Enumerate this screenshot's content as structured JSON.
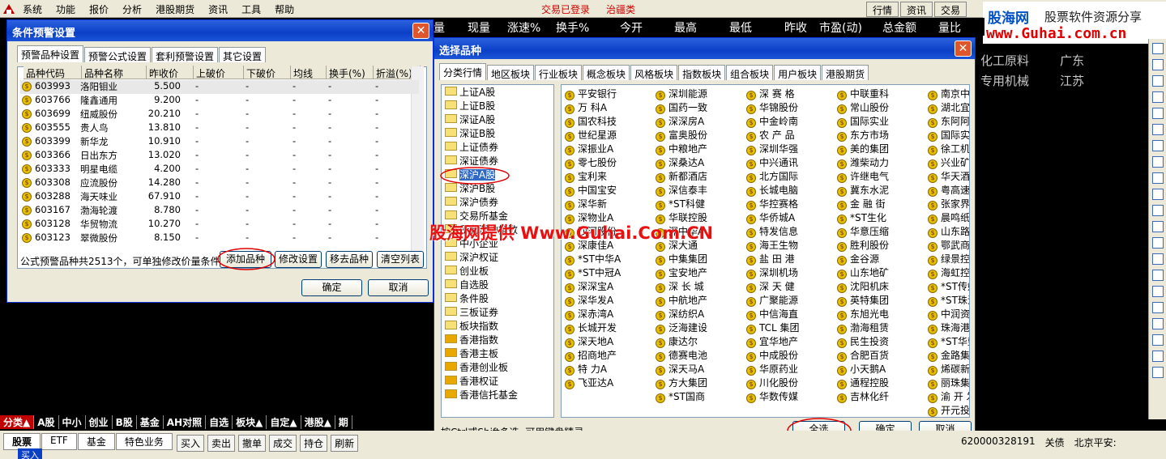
{
  "menubar": {
    "items": [
      "系统",
      "功能",
      "报价",
      "分析",
      "港股期货",
      "资讯",
      "工具",
      "帮助"
    ],
    "status_login": "交易已登录",
    "status_stock": "治疆类",
    "right_tabs": [
      "行情",
      "资讯",
      "交易"
    ]
  },
  "site": {
    "logo": "股海网",
    "slogan": "股票软件资源分享",
    "url": "www.Guhai.com.cn"
  },
  "quote_header": [
    "量",
    "现量",
    "涨速%",
    "换手%",
    "今开",
    "最高",
    "最低",
    "昨收",
    "市盈(动)",
    "总金额",
    "量比"
  ],
  "right_rows": [
    [
      "化工原料",
      "广东"
    ],
    [
      "专用机械",
      "江苏"
    ]
  ],
  "alert_dialog": {
    "title": "条件预警设置",
    "tabs": [
      "预警品种设置",
      "预警公式设置",
      "套利预警设置",
      "其它设置"
    ],
    "columns": [
      "品种代码",
      "品种名称",
      "昨收价",
      "上破价",
      "下破价",
      "均线",
      "换手(%)",
      "折溢(%)"
    ],
    "rows": [
      [
        "603993",
        "洛阳钼业",
        "5.500",
        "-",
        "-",
        "-",
        "-",
        "-"
      ],
      [
        "603766",
        "隆鑫通用",
        "9.200",
        "-",
        "-",
        "-",
        "-",
        "-"
      ],
      [
        "603699",
        "纽威股份",
        "20.210",
        "-",
        "-",
        "-",
        "-",
        "-"
      ],
      [
        "603555",
        "贵人鸟",
        "13.810",
        "-",
        "-",
        "-",
        "-",
        "-"
      ],
      [
        "603399",
        "新华龙",
        "10.910",
        "-",
        "-",
        "-",
        "-",
        "-"
      ],
      [
        "603366",
        "日出东方",
        "13.020",
        "-",
        "-",
        "-",
        "-",
        "-"
      ],
      [
        "603333",
        "明星电缆",
        "4.200",
        "-",
        "-",
        "-",
        "-",
        "-"
      ],
      [
        "603308",
        "应流股份",
        "14.280",
        "-",
        "-",
        "-",
        "-",
        "-"
      ],
      [
        "603288",
        "海天味业",
        "67.910",
        "-",
        "-",
        "-",
        "-",
        "-"
      ],
      [
        "603167",
        "渤海轮渡",
        "8.780",
        "-",
        "-",
        "-",
        "-",
        "-"
      ],
      [
        "603128",
        "华贸物流",
        "10.270",
        "-",
        "-",
        "-",
        "-",
        "-"
      ],
      [
        "603123",
        "翠微股份",
        "8.150",
        "-",
        "-",
        "-",
        "-",
        "-"
      ]
    ],
    "footer_text": "公式预警品种共2513个，可单独修改价量条件",
    "buttons": {
      "add": "添加品种",
      "modify": "修改设置",
      "remove": "移去品种",
      "clear": "清空列表",
      "ok": "确定",
      "cancel": "取消"
    }
  },
  "select_dialog": {
    "title": "选择品种",
    "tabs": [
      "分类行情",
      "地区板块",
      "行业板块",
      "概念板块",
      "风格板块",
      "指数板块",
      "组合板块",
      "用户板块",
      "港股期货"
    ],
    "folders": [
      "上证A股",
      "上证B股",
      "深证A股",
      "深证B股",
      "上证债券",
      "深证债券",
      "深沪A股",
      "深沪B股",
      "深沪债券",
      "交易所基金",
      "所有深沪指数",
      "中小企业",
      "深沪权证",
      "创业板",
      "自选股",
      "条件股",
      "三板证券",
      "板块指数",
      "香港指数",
      "香港主板",
      "香港创业板",
      "香港权证",
      "香港信托基金"
    ],
    "stocks": [
      [
        "平安银行",
        "万 科A",
        "国农科技",
        "世纪星源",
        "深振业A",
        "零七股份",
        "宝利来",
        "中国宝安",
        "深华新",
        "深物业A",
        "沙河股份",
        "深康佳A",
        "*ST中华A",
        "*ST中冠A",
        "深深宝A",
        "深华发A",
        "深赤湾A",
        "长城开发",
        "深天地A",
        "招商地产",
        "特 力A",
        "飞亚达A"
      ],
      [
        "深圳能源",
        "国药一致",
        "深深房A",
        "富奥股份",
        "中粮地产",
        "深桑达A",
        "新都酒店",
        "深信泰丰",
        "*ST科健",
        "华联控股",
        "深中华A",
        "深大通",
        "中集集团",
        "宝安地产",
        "深 长 城",
        "中航地产",
        "深纺织A",
        "泛海建设",
        "康达尔",
        "德赛电池",
        "深天马A",
        "方大集团",
        "*ST国商"
      ],
      [
        "深 赛 格",
        "华锦股份",
        "中金岭南",
        "农 产 品",
        "深圳华强",
        "中兴通讯",
        "北方国际",
        "长城电脑",
        "华控赛格",
        "华侨城A",
        "特发信息",
        "海王生物",
        "盐 田 港",
        "深圳机场",
        "深 天 健",
        "广聚能源",
        "中信海直",
        "TCL 集团",
        "宜华地产",
        "中成股份",
        "华原药业",
        "川化股份",
        "华数传媒"
      ],
      [
        "中联重科",
        "常山股份",
        "国际实业",
        "东方市场",
        "美的集团",
        "潍柴动力",
        "许继电气",
        "冀东水泥",
        "金 融 街",
        "*ST生化",
        "华意压缩",
        "胜利股份",
        "金谷源",
        "山东地矿",
        "沈阳机床",
        "英特集团",
        "东旭光电",
        "渤海租赁",
        "民生投资",
        "合肥百货",
        "小天鹅A",
        "通程控股",
        "吉林化纤"
      ],
      [
        "南京中北",
        "湖北宜化",
        "东阿阿胶",
        "国际实业",
        "徐工机械",
        "兴业矿业",
        "华天酒店",
        "粤高速A",
        "张家界",
        "晨鸣纸业",
        "山东路桥",
        "鄂武商A",
        "绿景控股",
        "海虹控股",
        "*ST传媒",
        "*ST珠江",
        "中润资源",
        "珠海港",
        "*ST华塑",
        "金路集团",
        "烯碳新材",
        "丽珠集团",
        "渝 开 发",
        "开元投资"
      ]
    ],
    "status_text": "按Ctrl或Shift多选, 可用键盘精灵",
    "buttons": {
      "select_all": "全选",
      "ok": "确定",
      "cancel": "取消"
    }
  },
  "watermark": "股海网提供 Www.Guhai.Com.CN",
  "bottom_tabs": [
    "分类▲",
    "A股",
    "中小",
    "创业",
    "B股",
    "基金",
    "AH对照",
    "自选",
    "板块▲",
    "自定▲",
    "港股▲",
    "期"
  ],
  "trade": {
    "tabs": [
      "股票",
      "ETF",
      "基金",
      "特色业务"
    ],
    "buttons": [
      "买入",
      "卖出",
      "撤单",
      "成交",
      "持仓",
      "刷新"
    ],
    "buy_label": "买入",
    "account": "620000328191",
    "account_label": "关债",
    "broker": "北京平安:"
  },
  "colors": {
    "title_blue": "#0a3fc6",
    "watermark_red": "#e81010",
    "active_tab": "#c00000"
  }
}
